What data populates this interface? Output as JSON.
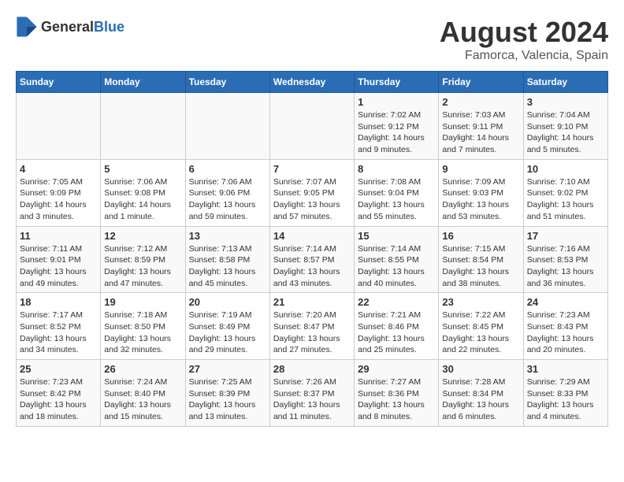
{
  "logo": {
    "general": "General",
    "blue": "Blue"
  },
  "title": "August 2024",
  "subtitle": "Famorca, Valencia, Spain",
  "days_of_week": [
    "Sunday",
    "Monday",
    "Tuesday",
    "Wednesday",
    "Thursday",
    "Friday",
    "Saturday"
  ],
  "weeks": [
    [
      {
        "day": "",
        "info": ""
      },
      {
        "day": "",
        "info": ""
      },
      {
        "day": "",
        "info": ""
      },
      {
        "day": "",
        "info": ""
      },
      {
        "day": "1",
        "info": "Sunrise: 7:02 AM\nSunset: 9:12 PM\nDaylight: 14 hours\nand 9 minutes."
      },
      {
        "day": "2",
        "info": "Sunrise: 7:03 AM\nSunset: 9:11 PM\nDaylight: 14 hours\nand 7 minutes."
      },
      {
        "day": "3",
        "info": "Sunrise: 7:04 AM\nSunset: 9:10 PM\nDaylight: 14 hours\nand 5 minutes."
      }
    ],
    [
      {
        "day": "4",
        "info": "Sunrise: 7:05 AM\nSunset: 9:09 PM\nDaylight: 14 hours\nand 3 minutes."
      },
      {
        "day": "5",
        "info": "Sunrise: 7:06 AM\nSunset: 9:08 PM\nDaylight: 14 hours\nand 1 minute."
      },
      {
        "day": "6",
        "info": "Sunrise: 7:06 AM\nSunset: 9:06 PM\nDaylight: 13 hours\nand 59 minutes."
      },
      {
        "day": "7",
        "info": "Sunrise: 7:07 AM\nSunset: 9:05 PM\nDaylight: 13 hours\nand 57 minutes."
      },
      {
        "day": "8",
        "info": "Sunrise: 7:08 AM\nSunset: 9:04 PM\nDaylight: 13 hours\nand 55 minutes."
      },
      {
        "day": "9",
        "info": "Sunrise: 7:09 AM\nSunset: 9:03 PM\nDaylight: 13 hours\nand 53 minutes."
      },
      {
        "day": "10",
        "info": "Sunrise: 7:10 AM\nSunset: 9:02 PM\nDaylight: 13 hours\nand 51 minutes."
      }
    ],
    [
      {
        "day": "11",
        "info": "Sunrise: 7:11 AM\nSunset: 9:01 PM\nDaylight: 13 hours\nand 49 minutes."
      },
      {
        "day": "12",
        "info": "Sunrise: 7:12 AM\nSunset: 8:59 PM\nDaylight: 13 hours\nand 47 minutes."
      },
      {
        "day": "13",
        "info": "Sunrise: 7:13 AM\nSunset: 8:58 PM\nDaylight: 13 hours\nand 45 minutes."
      },
      {
        "day": "14",
        "info": "Sunrise: 7:14 AM\nSunset: 8:57 PM\nDaylight: 13 hours\nand 43 minutes."
      },
      {
        "day": "15",
        "info": "Sunrise: 7:14 AM\nSunset: 8:55 PM\nDaylight: 13 hours\nand 40 minutes."
      },
      {
        "day": "16",
        "info": "Sunrise: 7:15 AM\nSunset: 8:54 PM\nDaylight: 13 hours\nand 38 minutes."
      },
      {
        "day": "17",
        "info": "Sunrise: 7:16 AM\nSunset: 8:53 PM\nDaylight: 13 hours\nand 36 minutes."
      }
    ],
    [
      {
        "day": "18",
        "info": "Sunrise: 7:17 AM\nSunset: 8:52 PM\nDaylight: 13 hours\nand 34 minutes."
      },
      {
        "day": "19",
        "info": "Sunrise: 7:18 AM\nSunset: 8:50 PM\nDaylight: 13 hours\nand 32 minutes."
      },
      {
        "day": "20",
        "info": "Sunrise: 7:19 AM\nSunset: 8:49 PM\nDaylight: 13 hours\nand 29 minutes."
      },
      {
        "day": "21",
        "info": "Sunrise: 7:20 AM\nSunset: 8:47 PM\nDaylight: 13 hours\nand 27 minutes."
      },
      {
        "day": "22",
        "info": "Sunrise: 7:21 AM\nSunset: 8:46 PM\nDaylight: 13 hours\nand 25 minutes."
      },
      {
        "day": "23",
        "info": "Sunrise: 7:22 AM\nSunset: 8:45 PM\nDaylight: 13 hours\nand 22 minutes."
      },
      {
        "day": "24",
        "info": "Sunrise: 7:23 AM\nSunset: 8:43 PM\nDaylight: 13 hours\nand 20 minutes."
      }
    ],
    [
      {
        "day": "25",
        "info": "Sunrise: 7:23 AM\nSunset: 8:42 PM\nDaylight: 13 hours\nand 18 minutes."
      },
      {
        "day": "26",
        "info": "Sunrise: 7:24 AM\nSunset: 8:40 PM\nDaylight: 13 hours\nand 15 minutes."
      },
      {
        "day": "27",
        "info": "Sunrise: 7:25 AM\nSunset: 8:39 PM\nDaylight: 13 hours\nand 13 minutes."
      },
      {
        "day": "28",
        "info": "Sunrise: 7:26 AM\nSunset: 8:37 PM\nDaylight: 13 hours\nand 11 minutes."
      },
      {
        "day": "29",
        "info": "Sunrise: 7:27 AM\nSunset: 8:36 PM\nDaylight: 13 hours\nand 8 minutes."
      },
      {
        "day": "30",
        "info": "Sunrise: 7:28 AM\nSunset: 8:34 PM\nDaylight: 13 hours\nand 6 minutes."
      },
      {
        "day": "31",
        "info": "Sunrise: 7:29 AM\nSunset: 8:33 PM\nDaylight: 13 hours\nand 4 minutes."
      }
    ]
  ]
}
